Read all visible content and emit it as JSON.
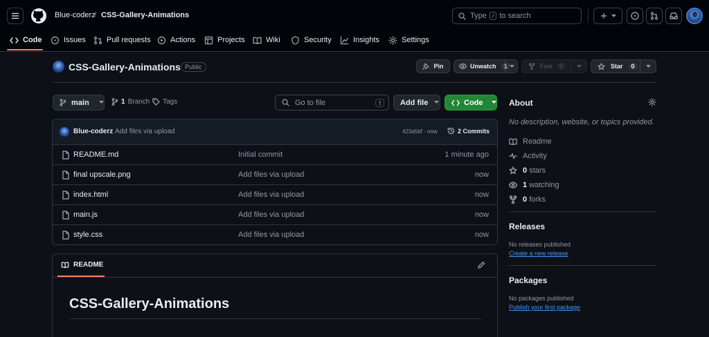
{
  "header": {
    "owner": "Blue-coderz",
    "separator": "/",
    "repo": "CSS-Gallery-Animations",
    "search_prefix": "Type",
    "search_key": "/",
    "search_suffix": "to search"
  },
  "tabs": [
    {
      "label": "Code",
      "icon": "code-icon",
      "active": true
    },
    {
      "label": "Issues",
      "icon": "issue-icon"
    },
    {
      "label": "Pull requests",
      "icon": "pull-request-icon"
    },
    {
      "label": "Actions",
      "icon": "play-icon"
    },
    {
      "label": "Projects",
      "icon": "table-icon"
    },
    {
      "label": "Wiki",
      "icon": "book-icon"
    },
    {
      "label": "Security",
      "icon": "shield-icon"
    },
    {
      "label": "Insights",
      "icon": "graph-icon"
    },
    {
      "label": "Settings",
      "icon": "gear-icon"
    }
  ],
  "repo": {
    "name": "CSS-Gallery-Animations",
    "visibility": "Public",
    "pin_label": "Pin",
    "unwatch_label": "Unwatch",
    "watch_count": "1",
    "fork_label": "Fork",
    "fork_count": "0",
    "star_label": "Star",
    "star_count": "0"
  },
  "toolbar": {
    "branch": "main",
    "branch_count": "1",
    "branch_label": "Branch",
    "tags_label": "Tags",
    "goto_placeholder": "Go to file",
    "goto_key": "t",
    "add_file_label": "Add file",
    "code_label": "Code"
  },
  "commit": {
    "author": "Blue-coderz",
    "message": "Add files via upload",
    "hash_time": "423a5bf · now",
    "commits_label": "2 Commits"
  },
  "files": [
    {
      "name": "README.md",
      "message": "Initial commit",
      "time": "1 minute ago"
    },
    {
      "name": "final upscale.png",
      "message": "Add files via upload",
      "time": "now"
    },
    {
      "name": "index.html",
      "message": "Add files via upload",
      "time": "now"
    },
    {
      "name": "main.js",
      "message": "Add files via upload",
      "time": "now"
    },
    {
      "name": "style.css",
      "message": "Add files via upload",
      "time": "now"
    }
  ],
  "readme": {
    "tab_label": "README",
    "heading": "CSS-Gallery-Animations"
  },
  "about": {
    "title": "About",
    "description": "No description, website, or topics provided.",
    "readme_label": "Readme",
    "activity_label": "Activity",
    "stars_count": "0",
    "stars_label": "stars",
    "watching_count": "1",
    "watching_label": "watching",
    "forks_count": "0",
    "forks_label": "forks"
  },
  "releases": {
    "title": "Releases",
    "empty": "No releases published",
    "link": "Create a new release"
  },
  "packages": {
    "title": "Packages",
    "empty": "No packages published",
    "link": "Publish your first package"
  },
  "colors": {
    "accent_green": "#238636",
    "link_blue": "#4493f8",
    "active_tab_underline": "#f78166"
  }
}
